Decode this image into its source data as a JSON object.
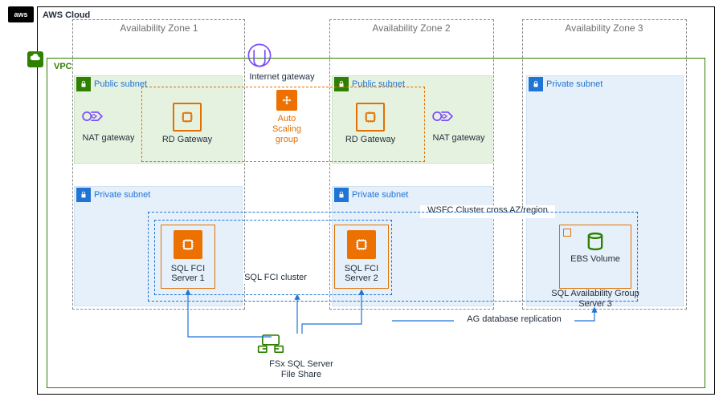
{
  "cloud": {
    "title": "AWS Cloud",
    "logo": "aws"
  },
  "vpc": {
    "title": "VPC"
  },
  "az": {
    "z1": "Availability Zone 1",
    "z2": "Availability Zone 2",
    "z3": "Availability Zone 3"
  },
  "subnets": {
    "pub1": "Public subnet",
    "pub2": "Public subnet",
    "priv1": "Private subnet",
    "priv2": "Private subnet",
    "priv3": "Private subnet"
  },
  "resources": {
    "igw": "Internet gateway",
    "asg": "Auto Scaling group",
    "nat1": "NAT gateway",
    "nat2": "NAT gateway",
    "rdgw1": "RD Gateway",
    "rdgw2": "RD Gateway",
    "sql1": "SQL FCI Server 1",
    "sql2": "SQL FCI Server 2",
    "sql3_a": "SQL Availability Group",
    "sql3_b": "Server 3",
    "ebs": "EBS Volume",
    "fsx_a": "FSx SQL Server",
    "fsx_b": "File Share"
  },
  "groups": {
    "fci": "SQL FCI cluster",
    "wsfc": "WSFC Cluster cross AZ/region",
    "asg_label_a": "Auto Scaling",
    "asg_label_b": "group",
    "ag_repl": "AG database replication"
  },
  "colors": {
    "green": "#2e8000",
    "blue": "#2074d5",
    "orange": "#ed7100",
    "orangeDark": "#e27000"
  }
}
